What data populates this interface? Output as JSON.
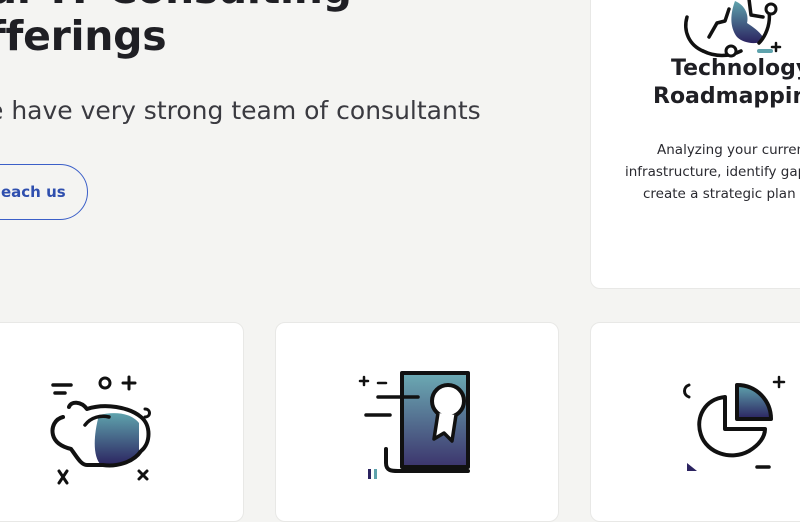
{
  "hero": {
    "title_line1": "ur IT Consulting",
    "title_line2": "fferings",
    "subtitle": "e have very strong team of consultants",
    "cta_label": "each us"
  },
  "cards": [
    {
      "title_line1": "Technology",
      "title_line2": "Roadmapping",
      "description_lines": [
        "Analyzing your curren",
        "infrastructure, identify gap",
        "create a strategic plan t"
      ],
      "icon": "globe-icon"
    },
    {
      "icon": "piggy-bank-icon"
    },
    {
      "icon": "certificate-icon"
    },
    {
      "icon": "pie-chart-icon"
    }
  ],
  "colors": {
    "background": "#f4f4f2",
    "card": "#ffffff",
    "accent_blue": "#3b5fc8",
    "icon_gradient_start": "#5fa3ad",
    "icon_gradient_end": "#2b2360",
    "text": "#1f1f24"
  }
}
